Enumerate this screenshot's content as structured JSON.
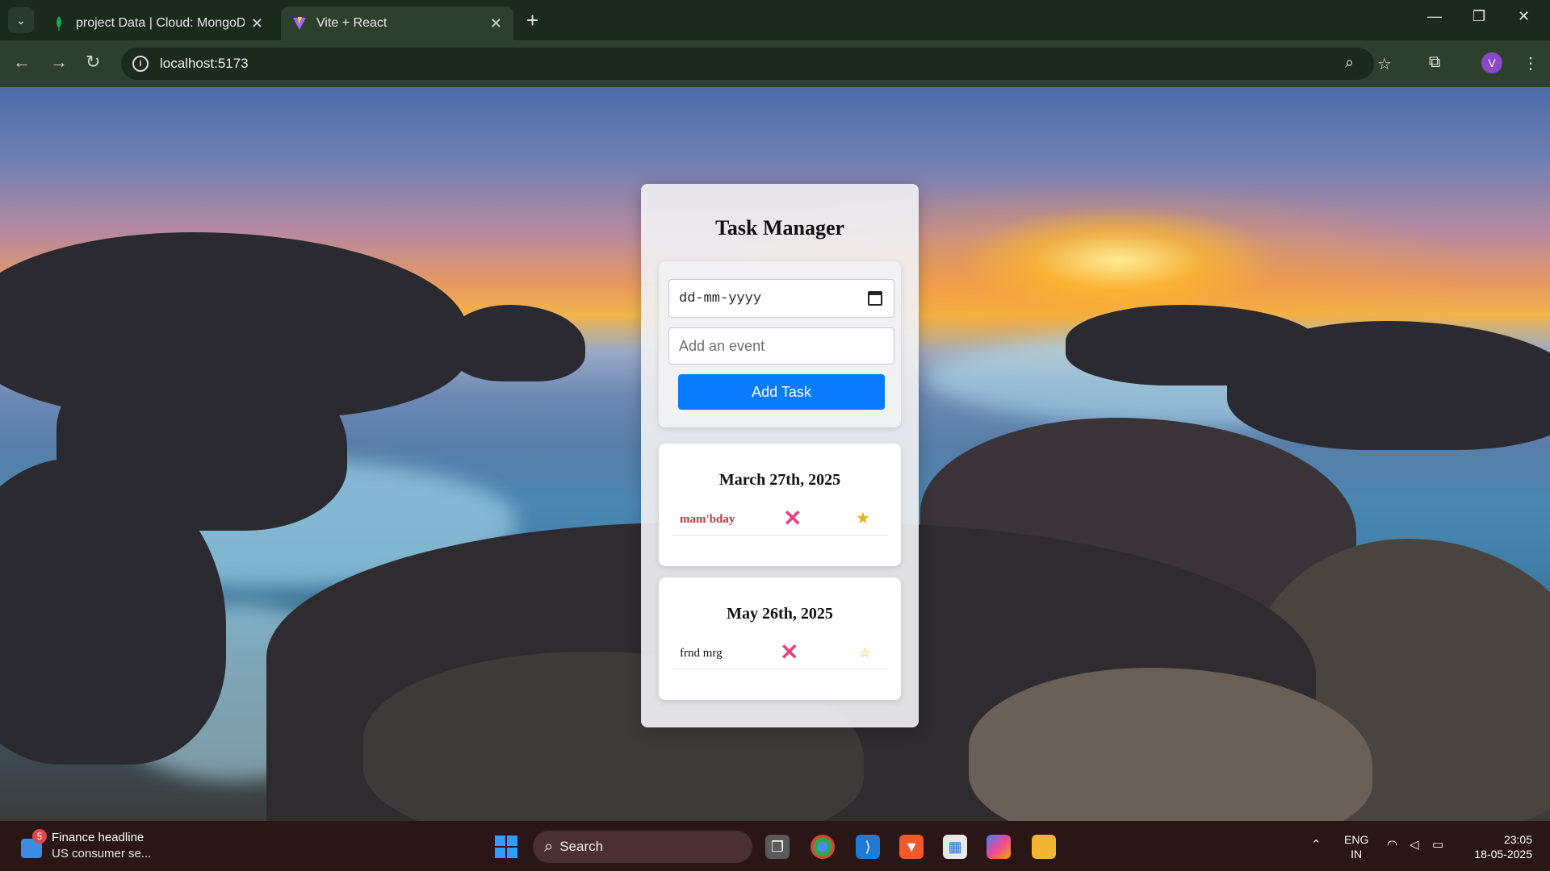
{
  "browser": {
    "tabs": [
      {
        "title": "project Data | Cloud: MongoDB",
        "active": false
      },
      {
        "title": "Vite + React",
        "active": true
      }
    ],
    "url": "localhost:5173",
    "profile_initial": "V"
  },
  "app": {
    "title": "Task Manager",
    "date_input": {
      "placeholder": "dd-mm-yyyy"
    },
    "event_input": {
      "placeholder": "Add an event"
    },
    "add_button": "Add Task",
    "groups": [
      {
        "date": "March 27th, 2025",
        "tasks": [
          {
            "name": "mam'bday",
            "completed": true,
            "starred": true
          }
        ]
      },
      {
        "date": "May 26th, 2025",
        "tasks": [
          {
            "name": "frnd mrg",
            "completed": false,
            "starred": false
          }
        ]
      }
    ]
  },
  "taskbar": {
    "news_badge": "5",
    "news_title": "Finance headline",
    "news_subtitle": "US consumer se...",
    "search_label": "Search",
    "language": "ENG",
    "region": "IN",
    "time": "23:05",
    "date": "18-05-2025"
  },
  "colors": {
    "accent_button": "#0a7bff",
    "delete_icon": "#e8437a",
    "star": "#e8b11e",
    "completed_task": "#c8363a"
  }
}
